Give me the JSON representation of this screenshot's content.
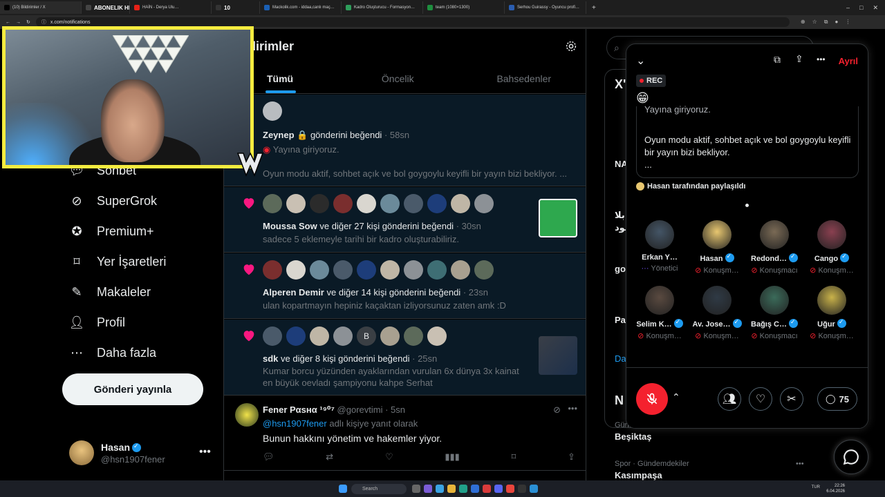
{
  "browser": {
    "tabs": [
      {
        "label": "(10) Bildirimler / X",
        "color": "#000000",
        "active": true
      },
      {
        "label": "ABONELIK HEDEFI",
        "color": "#444444",
        "bold": true
      },
      {
        "label": "HAİN - Derya Ulu…",
        "color": "#e62117"
      },
      {
        "label": "10",
        "color": "#333333",
        "bold": true
      },
      {
        "label": "Mackolik.com - iddaa,canlı maç…",
        "color": "#1a5fb4"
      },
      {
        "label": "Kadro Oluşturucu - Formasyon…",
        "color": "#2e9e5b"
      },
      {
        "label": "team (1080×1300)",
        "color": "#1e8e3e"
      },
      {
        "label": "Serhou Guirassy - Oyuncu profi…",
        "color": "#2a5db0"
      }
    ],
    "url": "x.com/notifications"
  },
  "nav": {
    "items": [
      {
        "label": "Sohbet",
        "icon": "chat-icon"
      },
      {
        "label": "SuperGrok",
        "icon": "grok-icon"
      },
      {
        "label": "Premium+",
        "icon": "premium-icon"
      },
      {
        "label": "Yer İşaretleri",
        "icon": "bookmark-icon"
      },
      {
        "label": "Makaleler",
        "icon": "article-icon"
      },
      {
        "label": "Profil",
        "icon": "profile-icon"
      },
      {
        "label": "Daha fazla",
        "icon": "more-icon"
      }
    ],
    "post_button": "Gönderi yayınla",
    "profile": {
      "name": "Hasan",
      "handle": "@hsn1907fener"
    }
  },
  "main": {
    "title": "dirimler",
    "tabs": [
      "Tümü",
      "Öncelik",
      "Bahsedenler"
    ],
    "notifications": [
      {
        "actor": "Zeynep",
        "action": "gönderini beğendi",
        "time": "58sn",
        "line1": "Yayına giriyoruz.",
        "line2": "Oyun modu aktif, sohbet açık ve bol goygoylu keyifli bir yayın bizi bekliyor. ..."
      },
      {
        "actor": "Moussa Sow",
        "action": "ve diğer 27 kişi gönderini beğendi",
        "time": "30sn",
        "line1": "sadece 5 eklemeyle tarihi bir kadro oluşturabiliriz."
      },
      {
        "actor": "Alperen Demir",
        "action": "ve diğer 14 kişi gönderini beğendi",
        "time": "23sn",
        "line1": "ulan kopartmayın hepiniz kaçaktan izliyorsunuz zaten amk :D"
      },
      {
        "actor": "sdk",
        "action": "ve diğer 8 kişi gönderini beğendi",
        "time": "25sn",
        "line1": "Kumar borcu yüzünden ayaklarından vurulan 6x dünya 3x kainat",
        "line2": "en büyük oevladı şampiyonu kahpe Serhat",
        "badge_letter": "B"
      }
    ],
    "reply": {
      "name": "Fener Ραsнα ¹⁹⁰⁷",
      "handle": "@gorevtimi",
      "time": "5sn",
      "mention": "@hsn1907fener",
      "mention_suffix": "adlı kişiye yanıt olarak",
      "text": "Bunun hakkını yönetim ve hakemler yiyor."
    }
  },
  "right": {
    "search_placeholder": "A",
    "trends": [
      {
        "cat": "Gündemdekiler",
        "name": "Beşiktaş"
      },
      {
        "cat": "Spor · Gündemdekiler",
        "name": "Kasımpaşa"
      }
    ],
    "snips": [
      "X'",
      "NA",
      "بلا",
      "مود",
      "go",
      "Pa",
      "Da",
      "N"
    ]
  },
  "space": {
    "leave": "Ayrıl",
    "rec": "REC",
    "emoji": "😁",
    "post_lines": [
      "Yayına giriyoruz.",
      "Oyun modu aktif, sohbet açık ve bol goygoylu keyifli bir yayın bizi bekliyor.",
      "..."
    ],
    "shared_by": "Hasan tarafından paylaşıldı",
    "speakers": [
      {
        "name": "Erkan Y…",
        "role": "Yönetici",
        "verified": false,
        "color": "#445566"
      },
      {
        "name": "Hasan",
        "role": "Konuşm…",
        "verified": true,
        "color": "#e8c770"
      },
      {
        "name": "Redond…",
        "role": "Konuşmacı",
        "verified": true,
        "color": "#7a6a55"
      },
      {
        "name": "Cango",
        "role": "Konuşm…",
        "verified": true,
        "color": "#8a4050"
      },
      {
        "name": "Selim K…",
        "role": "Konuşm…",
        "verified": true,
        "color": "#5a4a40"
      },
      {
        "name": "Av. Jose…",
        "role": "Konuşm…",
        "verified": true,
        "color": "#2f3a45"
      },
      {
        "name": "Bağış C…",
        "role": "Konuşmacı",
        "verified": true,
        "color": "#3b6b5a"
      },
      {
        "name": "Uğur",
        "role": "Konuşm…",
        "verified": true,
        "color": "#c9b24a"
      }
    ],
    "reply_count": "75"
  },
  "taskbar": {
    "search": "Search",
    "lang": "TUR",
    "time": "22:26",
    "date": "6.04.2026"
  }
}
